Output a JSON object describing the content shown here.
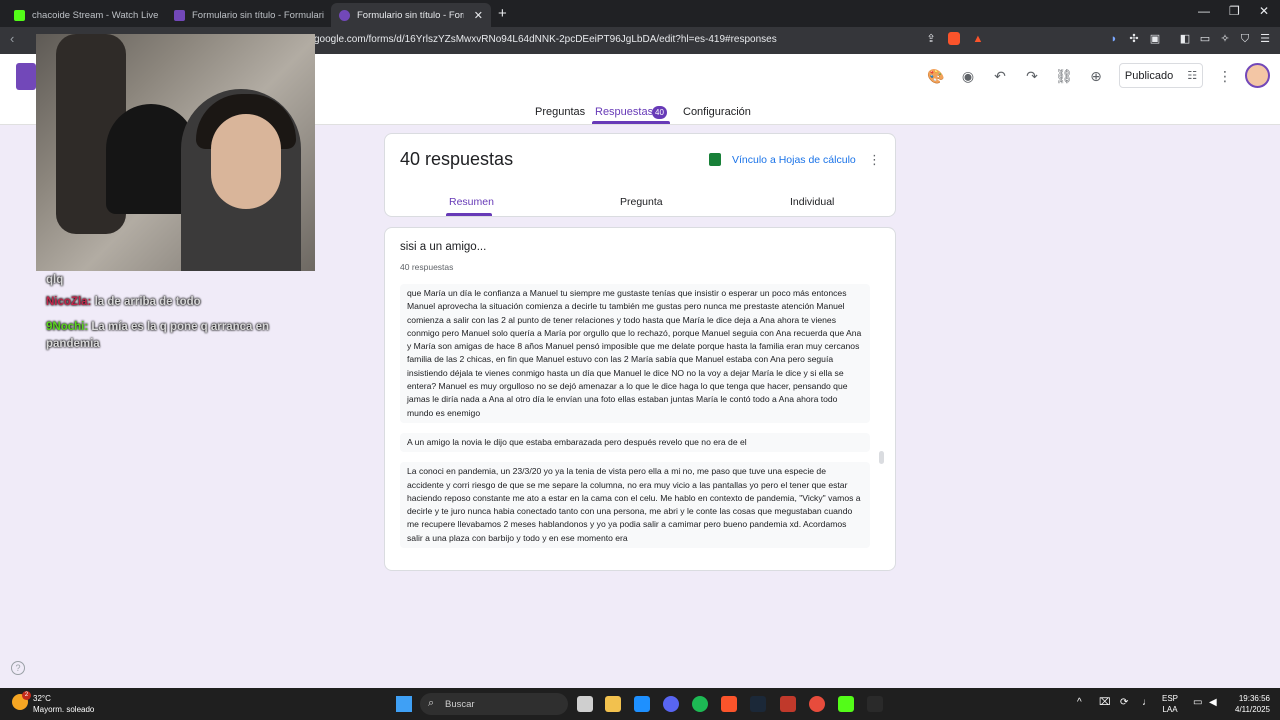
{
  "browser": {
    "tabs": [
      {
        "title": "chacoide Stream - Watch Live on",
        "favicon_color": "#53fc18"
      },
      {
        "title": "Formulario sin título - Formularios de",
        "favicon_color": "#7248b9"
      },
      {
        "title": "Formulario sin título - Formularios",
        "favicon_color": "#7248b9"
      }
    ],
    "url": "google.com/forms/d/16YrlszYZsMwxvRNo94L64dNNK-2pcDEeiPT96JgLbDA/edit?hl=es-419#responses"
  },
  "forms": {
    "nav_tabs": {
      "questions": "Preguntas",
      "responses": "Respuestas",
      "responses_count": "40",
      "settings": "Configuración"
    },
    "publish_label": "Publicado",
    "summary_title": "40 respuestas",
    "sheets_link": "Vínculo a Hojas de cálculo",
    "sub_tabs": {
      "summary": "Resumen",
      "question": "Pregunta",
      "individual": "Individual"
    },
    "question": {
      "title": "sisi a un amigo...",
      "count": "40 respuestas",
      "answers": [
        "que María un día le confianza a Manuel tu siempre me gustaste tenías que insistir o esperar un poco más entonces Manuel aprovecha la situación comienza a decirle tu también me gustas pero nunca me prestaste atención Manuel comienza a salir con las 2 al punto de tener relaciones y todo hasta que María le dice deja a Ana ahora te vienes conmigo pero Manuel solo quería a María por orgullo que lo rechazó, porque Manuel seguia con Ana recuerda que Ana y María son amigas de hace 8 años Manuel pensó imposible que me delate porque hasta la familia eran muy cercanos familia de las 2 chicas, en fin que Manuel estuvo con las 2 María sabía que Manuel estaba con Ana pero seguía insistiendo déjala te vienes conmigo hasta un día que Manuel le dice NO no la voy a dejar María le dice y si ella se entera? Manuel es muy orgulloso no se dejó amenazar a lo que le dice haga lo que tenga que hacer, pensando que jamas le diría nada a Ana al otro día le envían una foto ellas estaban juntas María le contó todo a Ana ahora todo mundo es enemigo",
        "A un amigo la novia le dijo que estaba embarazada pero después revelo que no era de el",
        "La conoci en pandemia, un 23/3/20 yo ya la tenia de vista pero ella a mi no, me paso que tuve una especie de accidente y corri riesgo de que se me separe la columna, no era muy vicio a las pantallas yo pero el tener que estar haciendo reposo constante me ato a estar en la cama con el celu. Me hablo en contexto de pandemia, \"Vicky\" vamos a decirle y te juro nunca habia conectado tanto con una persona, me abri y le conte las cosas que megustaban cuando me recupere llevabamos 2 meses hablandonos y yo ya podia salir a camimar pero bueno pandemia xd. Acordamos salir a una plaza con barbijo y todo y en ese momento era"
      ]
    }
  },
  "stream_chat": [
    {
      "name": "",
      "name_color": "#ffffff",
      "text": "qlq"
    },
    {
      "name": "NicoZla:",
      "name_color": "#c0264b",
      "text": "la de arriba de todo"
    },
    {
      "name": "9Nochi:",
      "name_color": "#5bd321",
      "text": "La mía es la q pone q arranca en pandemia"
    }
  ],
  "taskbar": {
    "temperature": "32°C",
    "weather_desc": "Mayorm. soleado",
    "weather_badge": "2",
    "search_placeholder": "Buscar",
    "lang": "ESP",
    "lang_sub": "LAA",
    "time": "19:36:56",
    "date": "4/11/2025"
  }
}
